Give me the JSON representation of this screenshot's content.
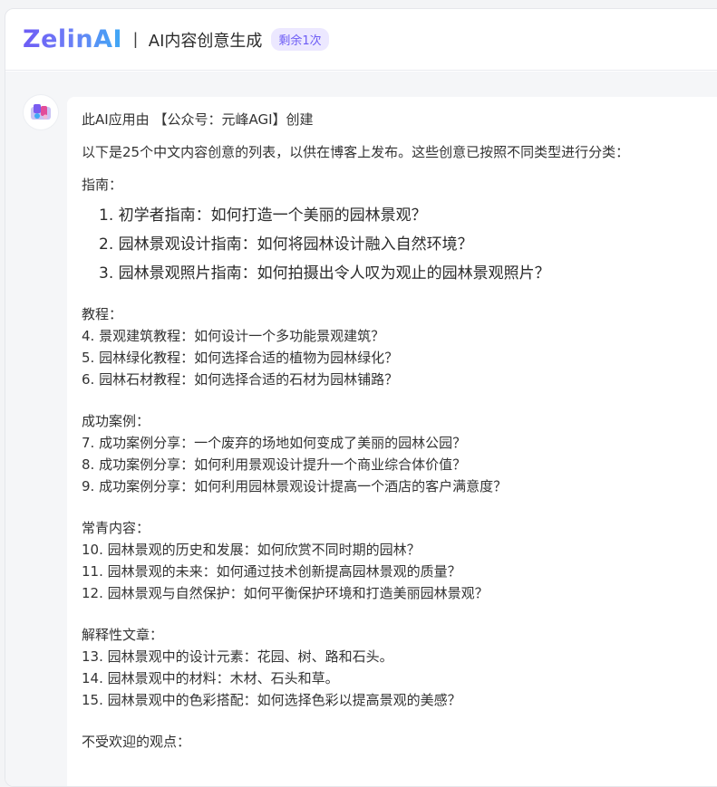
{
  "header": {
    "logo": "ZelinAI",
    "divider": "|",
    "title": "AI内容创意生成",
    "badge": "剩余1次"
  },
  "message": {
    "intro": "此AI应用由 【公众号：元峰AGI】创建",
    "summary": "以下是25个中文内容创意的列表，以供在博客上发布。这些创意已按照不同类型进行分类：",
    "guide_heading": "指南：",
    "guide_items": [
      "1. 初学者指南：如何打造一个美丽的园林景观？",
      "2. 园林景观设计指南：如何将园林设计融入自然环境？",
      "3. 园林景观照片指南：如何拍摄出令人叹为观止的园林景观照片？"
    ],
    "sections": [
      {
        "heading": "教程：",
        "items": [
          "4. 景观建筑教程：如何设计一个多功能景观建筑？",
          "5. 园林绿化教程：如何选择合适的植物为园林绿化？",
          "6. 园林石材教程：如何选择合适的石材为园林铺路？"
        ]
      },
      {
        "heading": "成功案例：",
        "items": [
          "7. 成功案例分享：一个废弃的场地如何变成了美丽的园林公园？",
          "8. 成功案例分享：如何利用景观设计提升一个商业综合体价值？",
          "9. 成功案例分享：如何利用园林景观设计提高一个酒店的客户满意度？"
        ]
      },
      {
        "heading": "常青内容：",
        "items": [
          "10. 园林景观的历史和发展：如何欣赏不同时期的园林？",
          "11. 园林景观的未来：如何通过技术创新提高园林景观的质量？",
          "12. 园林景观与自然保护：如何平衡保护环境和打造美丽园林景观？"
        ]
      },
      {
        "heading": "解释性文章：",
        "items": [
          "13. 园林景观中的设计元素：花园、树、路和石头。",
          "14. 园林景观中的材料：木材、石头和草。",
          "15. 园林景观中的色彩搭配：如何选择色彩以提高景观的美感？"
        ]
      },
      {
        "heading": "不受欢迎的观点：",
        "items": []
      }
    ]
  },
  "colors": {
    "accent": "#6d5cf5",
    "badge_bg": "#ece8ff",
    "page_bg": "#f5f6f8"
  },
  "icons": {
    "avatar": "bot-avatar-icon"
  }
}
